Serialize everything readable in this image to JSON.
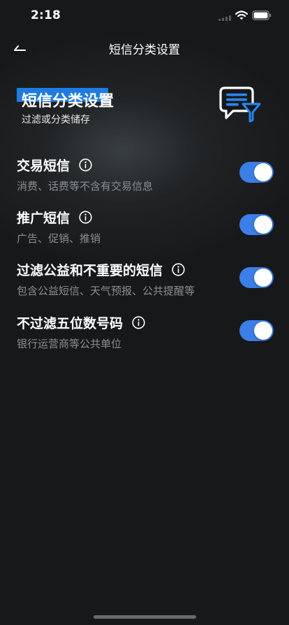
{
  "status_bar": {
    "time": "2:18"
  },
  "nav": {
    "title": "短信分类设置",
    "back_icon": "back-arrow-icon"
  },
  "header": {
    "title": "短信分类设置",
    "subtitle": "过滤或分类储存",
    "icon": "sms-filter-icon"
  },
  "settings": [
    {
      "title": "交易短信",
      "description": "消费、话费等不含有交易信息",
      "enabled": true
    },
    {
      "title": "推广短信",
      "description": "广告、促销、推销",
      "enabled": true
    },
    {
      "title": "过滤公益和不重要的短信",
      "description": "包含公益短信、天气预报、公共提醒等",
      "enabled": true
    },
    {
      "title": "不过滤五位数号码",
      "description": "银行运营商等公共单位",
      "enabled": true
    }
  ],
  "colors": {
    "accent": "#3a7ee6",
    "title_highlight": "#1f7be0",
    "background": "#17181a",
    "secondary_text": "#8b8e93"
  }
}
